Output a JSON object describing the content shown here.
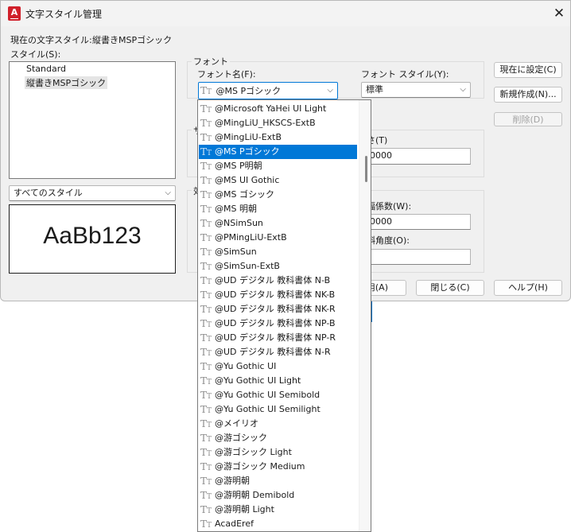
{
  "window": {
    "title": "文字スタイル管理"
  },
  "current_style": {
    "label": "現在の文字スタイル:",
    "value": "縦書きMSPゴシック"
  },
  "styles": {
    "label": "スタイル(S):",
    "items": [
      {
        "name": "Standard"
      },
      {
        "name": "縦書きMSPゴシック"
      }
    ],
    "filter_value": "すべてのスタイル",
    "preview_text": "AaBb123"
  },
  "font": {
    "group_label": "フォント",
    "name_label": "フォント名(F):",
    "name_value": "@MS Pゴシック",
    "style_label": "フォント スタイル(Y):",
    "style_value": "標準"
  },
  "size": {
    "group_label_partial": "サ",
    "height_label_partial": "さ(T)",
    "height_value": "0000"
  },
  "effects": {
    "group_label_partial": "効",
    "width_factor_label_partial": "幅係数(W):",
    "width_factor_value": "0000",
    "oblique_label_partial": "斜角度(O):",
    "oblique_value": ""
  },
  "buttons": {
    "set_current": "現在に設定(C)",
    "new": "新規作成(N)...",
    "delete": "削除(D)",
    "apply_partial": "用(A)",
    "close": "閉じる(C)",
    "help": "ヘルプ(H)"
  },
  "dropdown": {
    "selected_index": 3,
    "fonts": [
      "@Microsoft YaHei UI Light",
      "@MingLiU_HKSCS-ExtB",
      "@MingLiU-ExtB",
      "@MS Pゴシック",
      "@MS P明朝",
      "@MS UI Gothic",
      "@MS ゴシック",
      "@MS 明朝",
      "@NSimSun",
      "@PMingLiU-ExtB",
      "@SimSun",
      "@SimSun-ExtB",
      "@UD デジタル 教科書体 N-B",
      "@UD デジタル 教科書体 NK-B",
      "@UD デジタル 教科書体 NK-R",
      "@UD デジタル 教科書体 NP-B",
      "@UD デジタル 教科書体 NP-R",
      "@UD デジタル 教科書体 N-R",
      "@Yu Gothic UI",
      "@Yu Gothic UI Light",
      "@Yu Gothic UI Semibold",
      "@Yu Gothic UI Semilight",
      "@メイリオ",
      "@游ゴシック",
      "@游ゴシック Light",
      "@游ゴシック Medium",
      "@游明朝",
      "@游明朝 Demibold",
      "@游明朝 Light",
      "AcadEref"
    ]
  },
  "colors": {
    "selection": "#0078d7",
    "app_icon": "#d0202a"
  },
  "icons": {
    "font_type": "truetype-icon",
    "app": "autocad-app-icon",
    "close": "close-icon",
    "dropdown": "chevron-down-icon"
  }
}
